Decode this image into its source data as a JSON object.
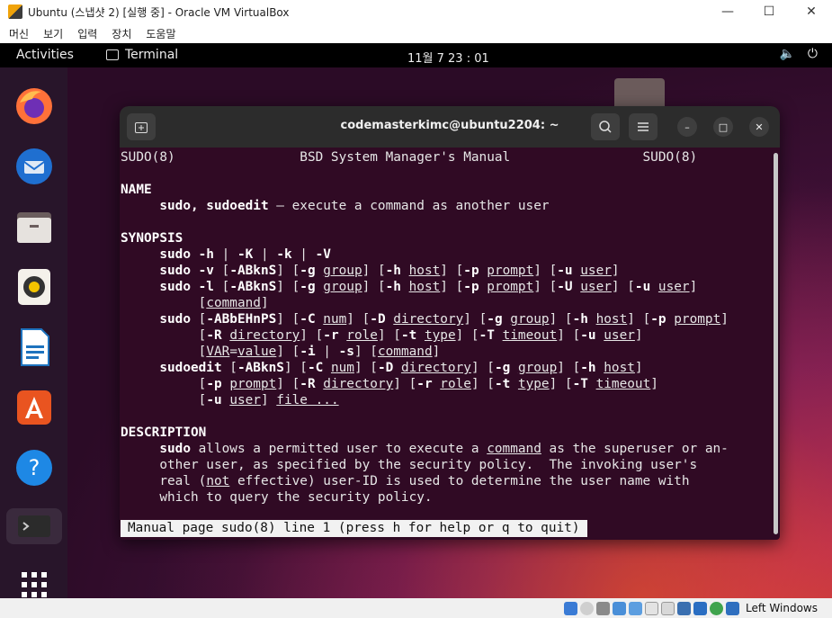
{
  "window": {
    "title": "Ubuntu (스냅샷 2) [실행 중] - Oracle VM VirtualBox"
  },
  "menu": [
    "머신",
    "보기",
    "입력",
    "장치",
    "도움말"
  ],
  "topbar": {
    "activities": "Activities",
    "app": "Terminal",
    "clock": "11월 7  23 : 01"
  },
  "terminal": {
    "title": "codemasterkimc@ubuntu2204: ~",
    "status": "Manual page sudo(8) line 1 (press h for help or q to quit)"
  },
  "manpage": {
    "header_left": "SUDO(8)",
    "header_center": "BSD System Manager's Manual",
    "header_right": "SUDO(8)",
    "name_heading": "NAME",
    "name_cmds": "sudo, sudoedit",
    "name_desc": " — execute a command as another user",
    "synopsis_heading": "SYNOPSIS",
    "description_heading": "DESCRIPTION",
    "desc_lines": [
      "other user, as specified by the security policy.  The invoking user's",
      "which to query the security policy."
    ]
  },
  "statusbar": {
    "host_key": "Left Windows"
  },
  "colors": {
    "terminal_bg": "#300a24",
    "accent": "#e95420"
  }
}
